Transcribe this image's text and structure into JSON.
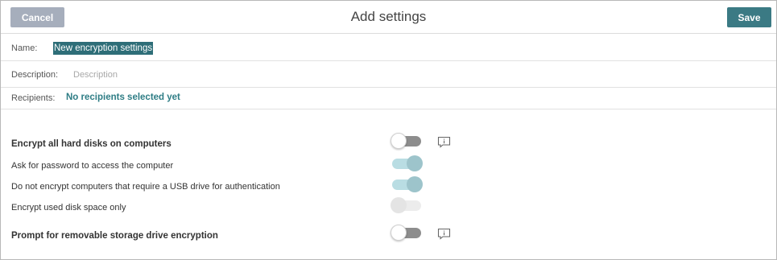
{
  "header": {
    "cancel_label": "Cancel",
    "title": "Add settings",
    "save_label": "Save"
  },
  "form": {
    "name_label": "Name:",
    "name_value": "New encryption settings",
    "description_label": "Description:",
    "description_placeholder": "Description",
    "recipients_label": "Recipients:",
    "recipients_value": "No recipients selected yet"
  },
  "settings": [
    {
      "label": "Encrypt all hard disks on computers",
      "state": "off",
      "has_info": true
    },
    {
      "label": "Ask for password to access the computer",
      "state": "on",
      "has_info": false
    },
    {
      "label": "Do not encrypt computers that require a USB drive for authentication",
      "state": "on",
      "has_info": false
    },
    {
      "label": "Encrypt used disk space only",
      "state": "disabled",
      "has_info": false
    },
    {
      "label": "Prompt for removable storage drive encryption",
      "state": "off",
      "has_info": true
    }
  ],
  "colors": {
    "accent": "#3b7a84",
    "cancel_button": "#a6aebc",
    "link": "#2e7d85",
    "name_highlight": "#2e6e78"
  },
  "icons": {
    "info": "info-message-icon"
  }
}
